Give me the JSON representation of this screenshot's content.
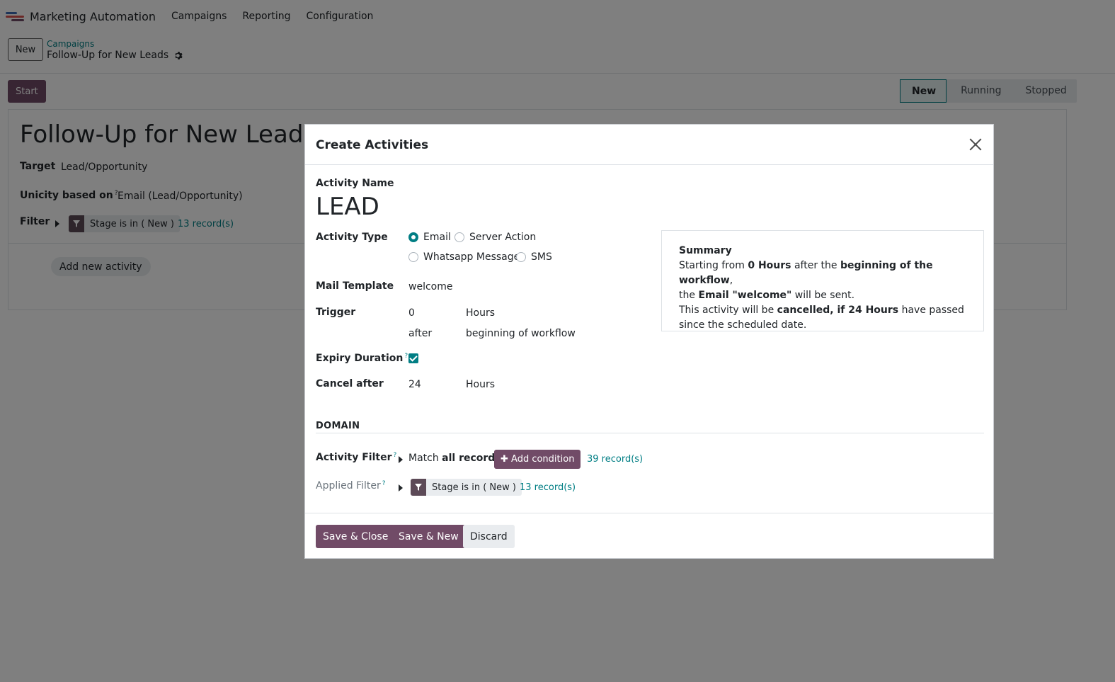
{
  "app": {
    "title": "Marketing Automation",
    "menu": [
      "Campaigns",
      "Reporting",
      "Configuration"
    ]
  },
  "control": {
    "new_label": "New",
    "breadcrumb_parent": "Campaigns",
    "breadcrumb_current": "Follow-Up for New Leads",
    "start_label": "Start"
  },
  "status": {
    "stages": [
      "New",
      "Running",
      "Stopped"
    ],
    "active": "New"
  },
  "record": {
    "title": "Follow-Up for New Leads",
    "target_label": "Target",
    "target_value": "Lead/Opportunity",
    "unicity_label": "Unicity based on",
    "unicity_help": "?",
    "unicity_value": "Email (Lead/Opportunity)",
    "filter_label": "Filter",
    "filter_tag": "Stage is in ( New )",
    "filter_count": "13 record(s)",
    "add_activity_label": "Add new activity"
  },
  "modal": {
    "title": "Create Activities",
    "activity_name_label": "Activity Name",
    "activity_name_value": "LEAD",
    "activity_type_label": "Activity Type",
    "activity_types": [
      "Email",
      "Server Action",
      "Whatsapp Message",
      "SMS"
    ],
    "activity_type_selected": "Email",
    "mail_template_label": "Mail Template",
    "mail_template_value": "welcome",
    "trigger_label": "Trigger",
    "trigger_value": "0",
    "trigger_unit": "Hours",
    "trigger_when": "after",
    "trigger_ref": "beginning of workflow",
    "expiry_label": "Expiry Duration",
    "expiry_help": "?",
    "expiry_checked": true,
    "cancel_label": "Cancel after",
    "cancel_value": "24",
    "cancel_unit": "Hours",
    "summary": {
      "title": "Summary",
      "l1_a": "Starting from ",
      "l1_b": "0 Hours",
      "l1_c": " after the ",
      "l1_d": "beginning of the workflow",
      "l1_e": ",",
      "l2_a": "the ",
      "l2_b": "Email \"welcome\"",
      "l2_c": " will be sent.",
      "l3_a": "This activity will be ",
      "l3_b": "cancelled, if 24 Hours",
      "l3_c": " have passed since the scheduled date."
    },
    "domain_header": "DOMAIN",
    "activity_filter_label": "Activity Filter",
    "activity_filter_help": "?",
    "match_prefix": "Match ",
    "match_bold": "all records",
    "add_condition_label": "Add condition",
    "activity_filter_count": "39 record(s)",
    "applied_filter_label": "Applied Filter",
    "applied_filter_help": "?",
    "applied_filter_tag": "Stage is in ( New )",
    "applied_filter_count": "13 record(s)",
    "save_close_label": "Save & Close",
    "save_new_label": "Save & New",
    "discard_label": "Discard"
  },
  "colors": {
    "primary": "#714b67",
    "accent": "#017e84"
  }
}
